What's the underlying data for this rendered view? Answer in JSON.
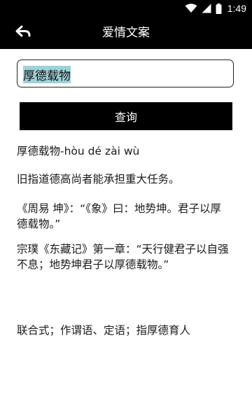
{
  "status_bar": {
    "time": "1:49",
    "icons": [
      "wifi-icon",
      "cellular-signal-icon",
      "battery-icon"
    ]
  },
  "app_bar": {
    "title": "爱情文案",
    "back_icon": "back-arrow-icon"
  },
  "search": {
    "value": "厚德载物",
    "selection_color": "#9fd1d8"
  },
  "query_button": {
    "label": "查询"
  },
  "result": {
    "word_pinyin": "厚德载物-hòu dé zài wù",
    "meaning": "旧指道德高尚者能承担重大任务。",
    "source1": "《周易 坤》：“《象》曰：地势坤。君子以厚德载物。”",
    "source2": "宗璞《东藏记》第一章：“天行健君子以自强不息；地势坤君子以厚德载物。”",
    "usage": "联合式；作谓语、定语；指厚德育人"
  },
  "colors": {
    "bar_background": "#000000",
    "page_background": "#ffffff",
    "button_background": "#000000"
  }
}
